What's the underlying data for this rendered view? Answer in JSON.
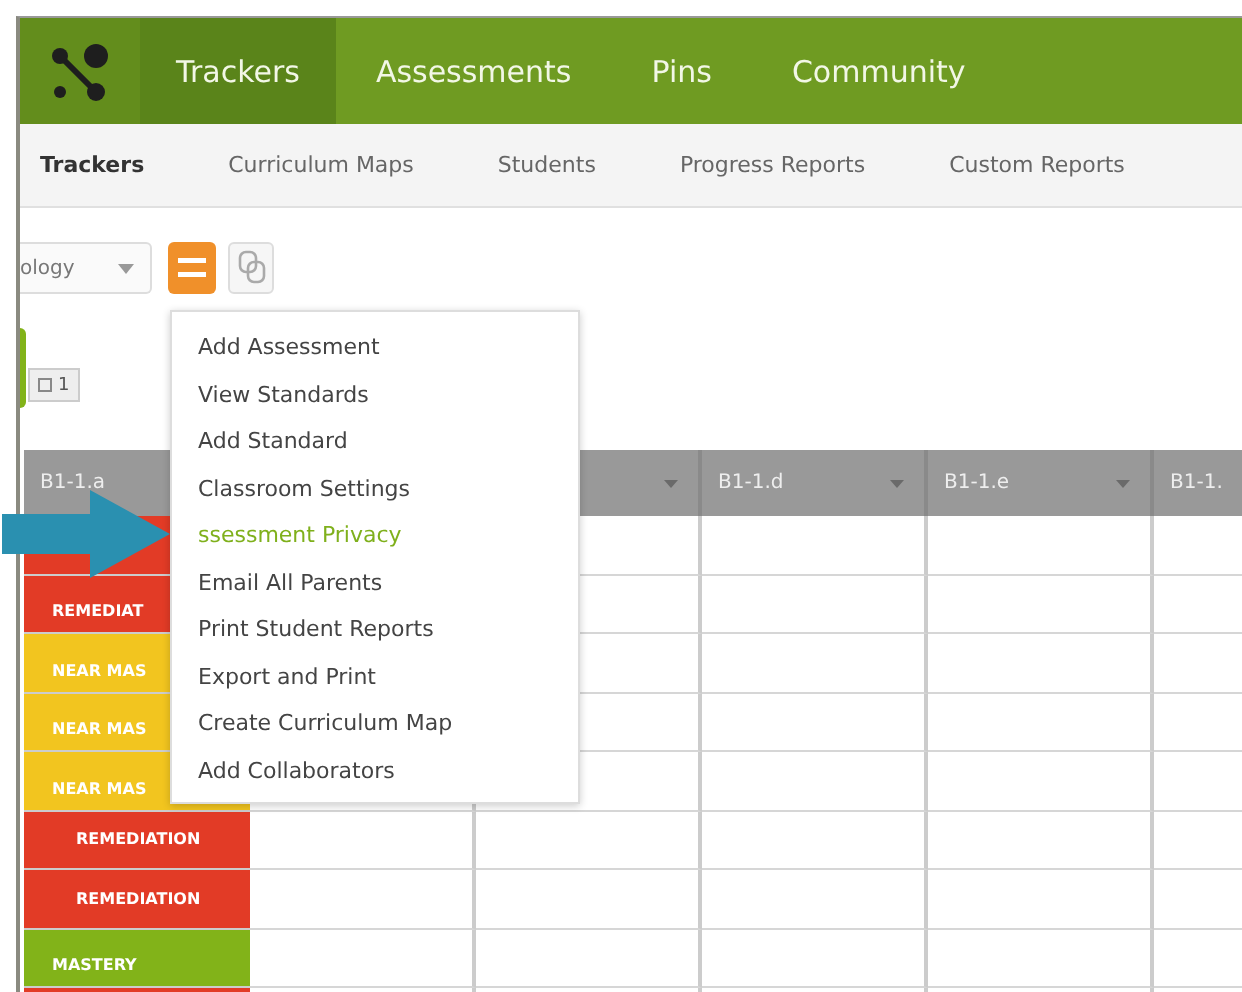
{
  "nav": {
    "items": [
      {
        "label": "Trackers",
        "selected": true
      },
      {
        "label": "Assessments",
        "selected": false
      },
      {
        "label": "Pins",
        "selected": false
      },
      {
        "label": "Community",
        "selected": false
      }
    ]
  },
  "subnav": {
    "items": [
      {
        "label": "Trackers",
        "selected": true
      },
      {
        "label": "Curriculum Maps",
        "selected": false
      },
      {
        "label": "Students",
        "selected": false
      },
      {
        "label": "Progress Reports",
        "selected": false
      },
      {
        "label": "Custom Reports",
        "selected": false
      }
    ]
  },
  "toolbar": {
    "dropdown_value": "ology"
  },
  "count_badge": "1",
  "table": {
    "columns": [
      {
        "label": "B1-1.a"
      },
      {},
      {
        "caret": true
      },
      {
        "label": "B1-1.d",
        "caret": true
      },
      {
        "label": "B1-1.e",
        "caret": true
      },
      {
        "label": "B1-1."
      }
    ],
    "rows": [
      {
        "color": "#e23b26"
      },
      {
        "label": "REMEDIAT",
        "color": "#e23b26"
      },
      {
        "label": "NEAR MAS",
        "color": "#f2c51f"
      },
      {
        "label": "NEAR MAS",
        "color": "#f2c51f"
      },
      {
        "label": "NEAR MAS",
        "color": "#f2c51f"
      },
      {
        "label": "REMEDIATION",
        "color": "#e23b26"
      },
      {
        "label": "REMEDIATION",
        "color": "#e23b26"
      },
      {
        "label": "MASTERY",
        "color": "#82b319"
      },
      {
        "color": "#e23b26"
      }
    ]
  },
  "menu": {
    "items": [
      {
        "label": "Add Assessment",
        "selected": false
      },
      {
        "label": "View Standards",
        "selected": false
      },
      {
        "label": "Add Standard",
        "selected": false
      },
      {
        "label": "Classroom Settings",
        "selected": false
      },
      {
        "label": "ssessment Privacy",
        "selected": true
      },
      {
        "label": "Email All Parents",
        "selected": false
      },
      {
        "label": "Print Student Reports",
        "selected": false
      },
      {
        "label": "Export and Print",
        "selected": false
      },
      {
        "label": "Create Curriculum Map",
        "selected": false
      },
      {
        "label": "Add Collaborators",
        "selected": false
      }
    ]
  }
}
